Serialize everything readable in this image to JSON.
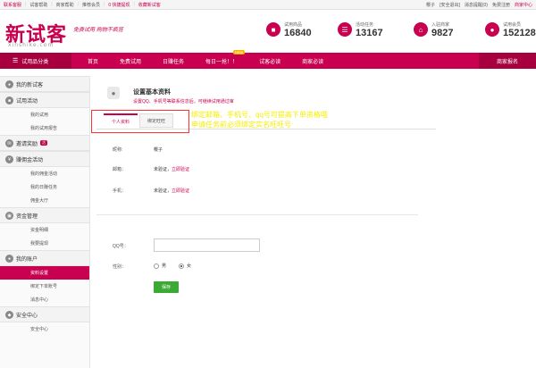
{
  "topbar": {
    "left_links": [
      {
        "label": "联系客服",
        "red": true
      },
      {
        "label": "试客帮助",
        "red": false
      },
      {
        "label": "商家帮助",
        "red": false
      },
      {
        "label": "推荐会员",
        "red": false
      },
      {
        "label": "0 快捷提现",
        "red": false
      },
      {
        "label": "收藏新试客",
        "red": true
      }
    ],
    "user": "樱子",
    "right_links": [
      {
        "label": "[安全退出]",
        "red": false
      },
      {
        "label": "消息提醒(0)",
        "red": false
      },
      {
        "label": "免费注册",
        "red": false
      },
      {
        "label": "商家中心",
        "red": true
      }
    ]
  },
  "header": {
    "logo": "新试客",
    "logo_sub": "xinshike.com",
    "slogan": "免费试用  购物不疯狂",
    "stats": [
      {
        "label": "试用商品",
        "value": "16840",
        "icon": "gift-icon"
      },
      {
        "label": "活动任务",
        "value": "13167",
        "icon": "list-icon"
      },
      {
        "label": "入驻商家",
        "value": "9827",
        "icon": "shop-icon"
      },
      {
        "label": "试用会员",
        "value": "152128",
        "icon": "user-icon"
      }
    ]
  },
  "nav": {
    "category_label": "试用品分类",
    "items": [
      "首页",
      "免费试用",
      "日赚任务",
      "每日一抢！！",
      "试客必读",
      "商家必读"
    ],
    "hot_badge": "NEW",
    "merchant_button": "商家报名"
  },
  "sidebar": {
    "groups": [
      {
        "label": "我的新试客",
        "icon": "user-icon",
        "items": []
      },
      {
        "label": "试用活动",
        "icon": "gift-icon",
        "items": [
          "我的试用",
          "我的试用报告"
        ]
      },
      {
        "label": "邀请奖励",
        "icon": "mail-icon",
        "badge": "活",
        "items": []
      },
      {
        "label": "赚佣金活动",
        "icon": "money-icon",
        "items": [
          "我的佣金活动",
          "我的日赚任务",
          "佣金大厅"
        ]
      },
      {
        "label": "资金管理",
        "icon": "wallet-icon",
        "items": [
          "资金明细",
          "我要提现"
        ]
      },
      {
        "label": "我的账户",
        "icon": "account-icon",
        "items": [
          "资料设置",
          "绑定下单账号",
          "消息中心"
        ]
      },
      {
        "label": "安全中心",
        "icon": "lock-icon",
        "items": [
          "安全中心"
        ]
      }
    ],
    "active_item": "资料设置"
  },
  "main": {
    "title": "设置基本资料",
    "subtitle": "设置QQ、手机号等联系信息后，可继续试用通过审",
    "tabs": [
      "个人资料",
      "绑定旺旺"
    ],
    "note_line1": "绑定邮箱、手机号、qq号可提高下单资格哦",
    "note_line2": "申请任务前必须绑定实名旺旺号",
    "fields": {
      "nickname_label": "昵称:",
      "nickname_value": "樱子",
      "email_label": "邮箱：",
      "email_status": "未验证，",
      "email_link": "立即验证",
      "phone_label": "手机：",
      "phone_status": "未验证，",
      "phone_link": "立即验证",
      "qq_label": "QQ号：",
      "qq_value": "",
      "gender_label": "性别：",
      "gender_male": "男",
      "gender_female": "女",
      "gender_selected": "女",
      "save_label": "保存"
    }
  },
  "colors": {
    "brand": "#c8004f",
    "note": "#f5ee00",
    "save": "#3aaa35"
  }
}
